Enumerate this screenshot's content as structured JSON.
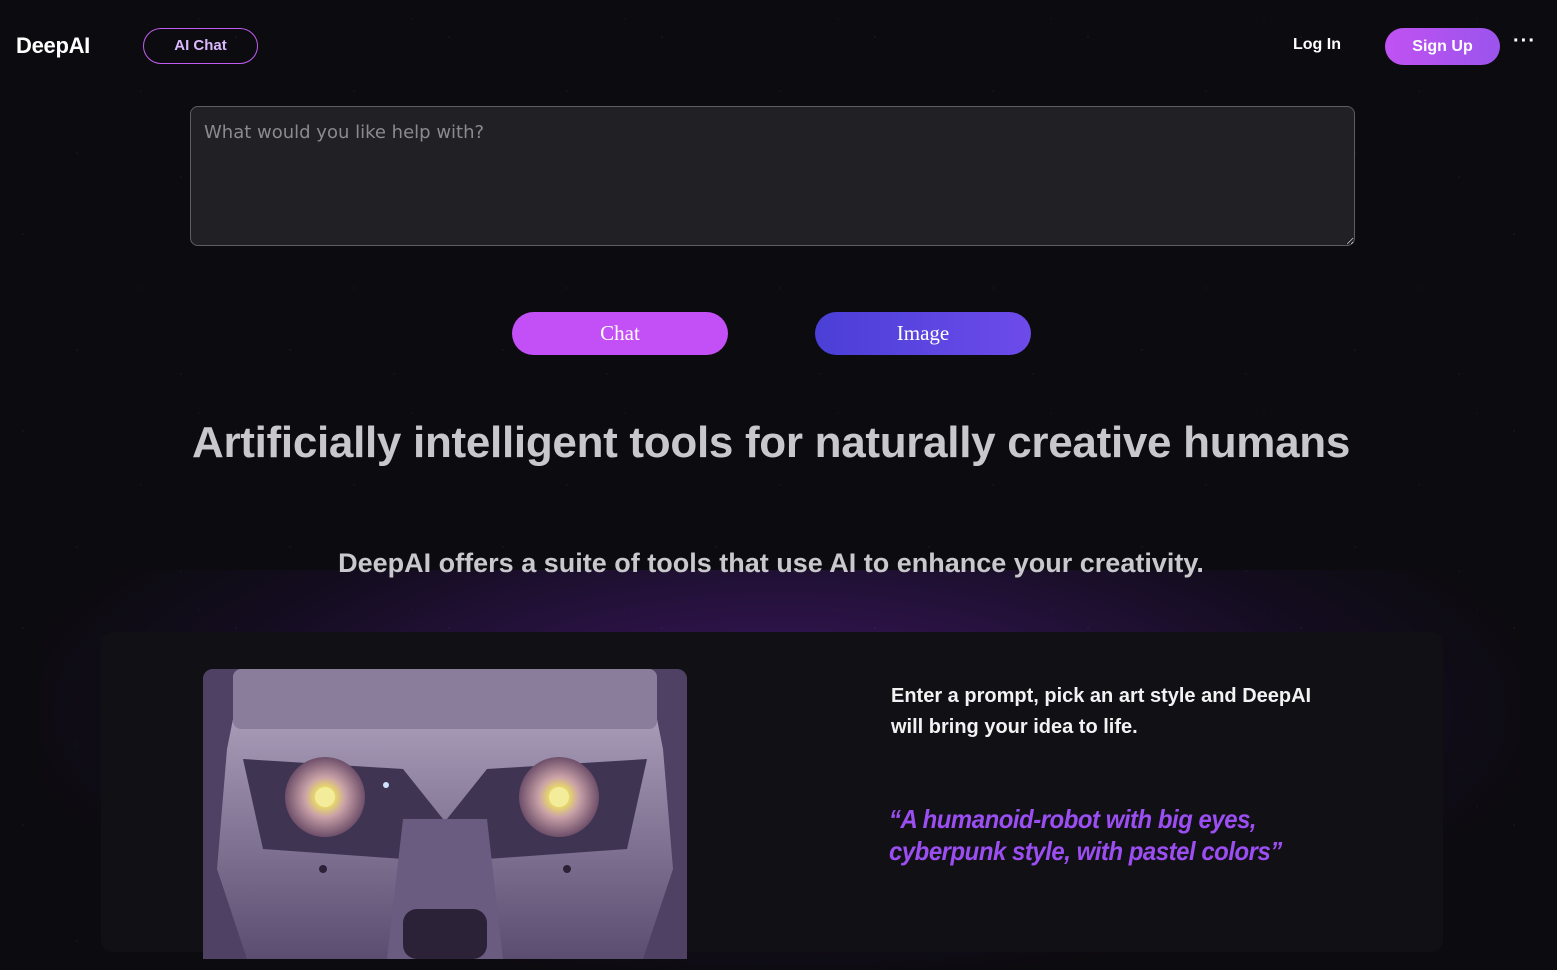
{
  "header": {
    "logo": "DeepAI",
    "nav_pill": "AI Chat",
    "login": "Log In",
    "signup": "Sign Up",
    "more_icon": "ellipsis-icon",
    "more": "···"
  },
  "prompt": {
    "placeholder": "What would you like help with?"
  },
  "mode_buttons": {
    "chat": "Chat",
    "image": "Image"
  },
  "hero": {
    "headline": "Artificially intelligent tools for naturally creative humans",
    "subhead": "DeepAI offers a suite of tools that use AI to enhance your creativity."
  },
  "feature_card": {
    "image_alt": "robot-face-artwork",
    "description": "Enter a prompt, pick an art style and DeepAI will bring your idea to life.",
    "example_prompt": "“A humanoid-robot with big eyes, cyberpunk style, with pastel colors”"
  },
  "colors": {
    "background": "#0c0b0f",
    "accent_pink": "#c34ff6",
    "accent_indigo": "#5a44e0",
    "quote_purple": "#9b4ef2"
  }
}
